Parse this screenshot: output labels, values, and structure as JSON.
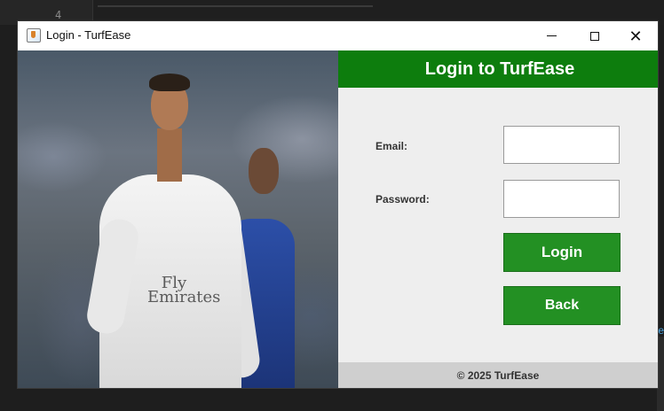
{
  "ide": {
    "line_number": "4",
    "right_edge_char": "e"
  },
  "window": {
    "title": "Login - TurfEase",
    "icons": {
      "app": "java-app-icon",
      "minimize": "minimize-icon",
      "maximize": "maximize-icon",
      "close": "close-icon"
    },
    "close_glyph": "✕"
  },
  "photo": {
    "sponsor_text": "Fly\nEmirates"
  },
  "form": {
    "header_title": "Login to TurfEase",
    "email_label": "Email:",
    "email_value": "",
    "password_label": "Password:",
    "password_value": "",
    "login_label": "Login",
    "back_label": "Back",
    "footer": "© 2025 TurfEase"
  },
  "colors": {
    "header_green": "#0d7d0d",
    "button_green": "#239023",
    "panel_bg": "#eeeeee",
    "footer_bg": "#cfcfcf"
  }
}
